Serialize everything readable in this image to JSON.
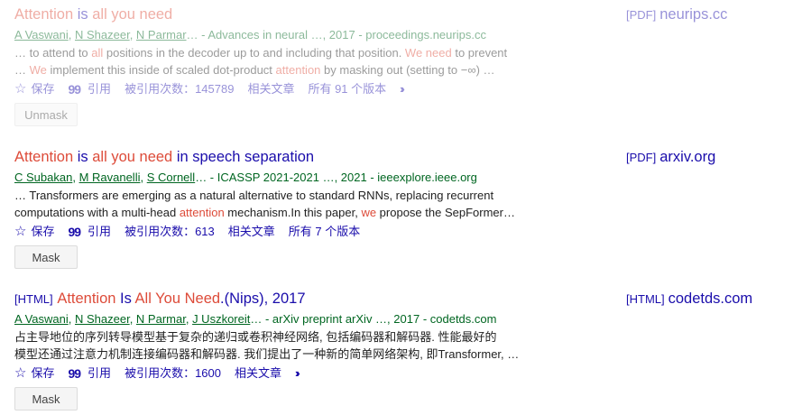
{
  "results": [
    {
      "title_parts": [
        {
          "text": "Attention",
          "style": "red"
        },
        {
          "text": " is ",
          "style": "blue"
        },
        {
          "text": "all you need",
          "style": "red"
        }
      ],
      "authors": [
        "A Vaswani",
        "N Shazeer",
        "N Parmar"
      ],
      "meta": "… - Advances in neural …, 2017 - proceedings.neurips.cc",
      "snippet_lines": [
        [
          {
            "text": "… to attend to ",
            "hl": false
          },
          {
            "text": "all",
            "hl": true
          },
          {
            "text": " positions in the decoder up to and including that position. ",
            "hl": false
          },
          {
            "text": "We need",
            "hl": true
          },
          {
            "text": " to prevent",
            "hl": false
          }
        ],
        [
          {
            "text": "… ",
            "hl": false
          },
          {
            "text": "We",
            "hl": true
          },
          {
            "text": " implement this inside of scaled dot-product ",
            "hl": false
          },
          {
            "text": "attention",
            "hl": true
          },
          {
            "text": " by masking out (setting to −∞) …",
            "hl": false
          }
        ]
      ],
      "actions": {
        "save": "保存",
        "cite": "引用",
        "cited_by": "被引用次数：145789",
        "related": "相关文章",
        "versions": "所有 91 个版本"
      },
      "button_label": "Unmask",
      "source_tag": "[PDF]",
      "source_site": "neurips.cc"
    },
    {
      "title_parts": [
        {
          "text": "Attention",
          "style": "red"
        },
        {
          "text": " is ",
          "style": "blue"
        },
        {
          "text": "all you need",
          "style": "red"
        },
        {
          "text": " in speech separation",
          "style": "blue"
        }
      ],
      "authors": [
        "C Subakan",
        "M Ravanelli",
        "S Cornell"
      ],
      "meta": "… - ICASSP 2021-2021 …, 2021 - ieeexplore.ieee.org",
      "snippet_lines": [
        [
          {
            "text": "… Transformers are emerging as a natural alternative to standard RNNs, replacing recurrent",
            "hl": false
          }
        ],
        [
          {
            "text": "computations with a multi-head ",
            "hl": false
          },
          {
            "text": "attention",
            "hl": true
          },
          {
            "text": " mechanism.In this paper, ",
            "hl": false
          },
          {
            "text": "we",
            "hl": true
          },
          {
            "text": " propose the SepFormer…",
            "hl": false
          }
        ]
      ],
      "actions": {
        "save": "保存",
        "cite": "引用",
        "cited_by": "被引用次数：613",
        "related": "相关文章",
        "versions": "所有 7 个版本"
      },
      "button_label": "Mask",
      "source_tag": "[PDF]",
      "source_site": "arxiv.org"
    },
    {
      "title_tag": "[HTML]",
      "title_parts": [
        {
          "text": "Attention",
          "style": "red"
        },
        {
          "text": " Is ",
          "style": "blue"
        },
        {
          "text": "All You Need",
          "style": "red"
        },
        {
          "text": ".(Nips), 2017",
          "style": "blue"
        }
      ],
      "authors": [
        "A Vaswani",
        "N Shazeer",
        "N Parmar",
        "J Uszkoreit"
      ],
      "meta": "… - arXiv preprint arXiv …, 2017 - codetds.com",
      "snippet_lines": [
        [
          {
            "text": "占主导地位的序列转导模型基于复杂的递归或卷积神经网络, 包括编码器和解码器. 性能最好的",
            "hl": false
          }
        ],
        [
          {
            "text": "模型还通过注意力机制连接编码器和解码器. 我们提出了一种新的简单网络架构, 即Transformer, …",
            "hl": false
          }
        ]
      ],
      "actions": {
        "save": "保存",
        "cite": "引用",
        "cited_by": "被引用次数：1600",
        "related": "相关文章"
      },
      "button_label": "Mask",
      "source_tag": "[HTML]",
      "source_site": "codetds.com"
    }
  ],
  "icons": {
    "save": "star-outline-icon",
    "cite": "quote-icon",
    "more": "double-chevron-right-icon"
  },
  "colors": {
    "link": "#1a0dab",
    "highlight": "#dd4b39",
    "authors": "#006621"
  }
}
